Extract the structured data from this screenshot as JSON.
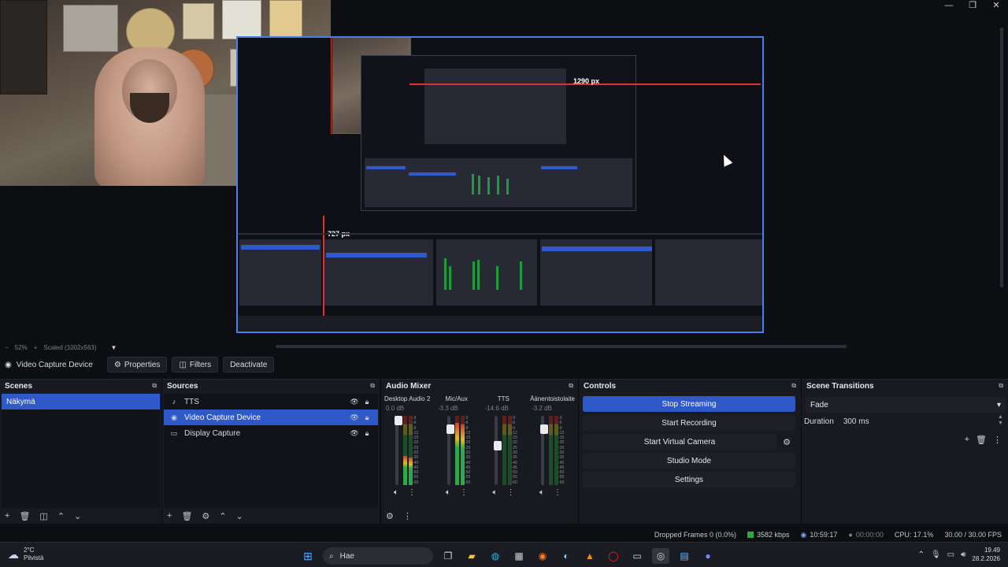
{
  "window": {
    "minimize": "—",
    "maximize": "❐",
    "close": "✕"
  },
  "preview": {
    "nested_label_width": "1290 px",
    "nested_label_height": "727 px"
  },
  "zoom": {
    "zoom_out": "−",
    "percent": "52%",
    "zoom_in": "+",
    "scale_info": "Scaled (1002x563)",
    "dropdown": "▼"
  },
  "context": {
    "source_name": "Video Capture Device",
    "properties": "Properties",
    "filters": "Filters",
    "deactivate": "Deactivate"
  },
  "scenes": {
    "title": "Scenes",
    "items": [
      "Näkymä"
    ]
  },
  "sources": {
    "title": "Sources",
    "items": [
      {
        "name": "TTS",
        "icon": "♪"
      },
      {
        "name": "Video Capture Device",
        "icon": "◉"
      },
      {
        "name": "Display Capture",
        "icon": "▭"
      }
    ]
  },
  "mixer": {
    "title": "Audio Mixer",
    "channels": [
      {
        "name": "Desktop Audio 2",
        "db": "0.0 dB",
        "level": 0.0,
        "meter": [
          0.42,
          0.4
        ],
        "fader": 1.0
      },
      {
        "name": "Mic/Aux",
        "db": "-3.3 dB",
        "level": 0.0,
        "meter": [
          0.9,
          0.88
        ],
        "fader": 0.86
      },
      {
        "name": "TTS",
        "db": "-14.6 dB",
        "level": 0.0,
        "meter": [
          0.0,
          0.0
        ],
        "fader": 0.58
      },
      {
        "name": "Äänentoistolaite",
        "db": "-3.2 dB",
        "level": 0.0,
        "meter": [
          0.0,
          0.0
        ],
        "fader": 0.86
      }
    ],
    "scale": [
      "-3",
      "-6",
      "-9",
      "-12",
      "-15",
      "-20",
      "-25",
      "-30",
      "-35",
      "-40",
      "-45",
      "-50",
      "-55",
      "-60"
    ]
  },
  "controls": {
    "title": "Controls",
    "stop_streaming": "Stop Streaming",
    "start_recording": "Start Recording",
    "start_virtual_camera": "Start Virtual Camera",
    "studio_mode": "Studio Mode",
    "settings": "Settings"
  },
  "transitions": {
    "title": "Scene Transitions",
    "selected": "Fade",
    "duration_label": "Duration",
    "duration_value": "300 ms"
  },
  "status": {
    "dropped_frames": "Dropped Frames 0 (0.0%)",
    "bitrate": "3582 kbps",
    "stream_time": "10:59:17",
    "record_time": "00:00:00",
    "cpu": "CPU: 17.1%",
    "fps": "30.00 / 30.00 FPS"
  },
  "taskbar": {
    "temperature": "2°C",
    "weather": "Pilvistä",
    "search": "Hae",
    "time": "19.49",
    "date": "28.2.2026"
  },
  "colors": {
    "accent": "#2f58c9",
    "selection_red": "#e0312f",
    "meter_green": "#2ea84a"
  }
}
